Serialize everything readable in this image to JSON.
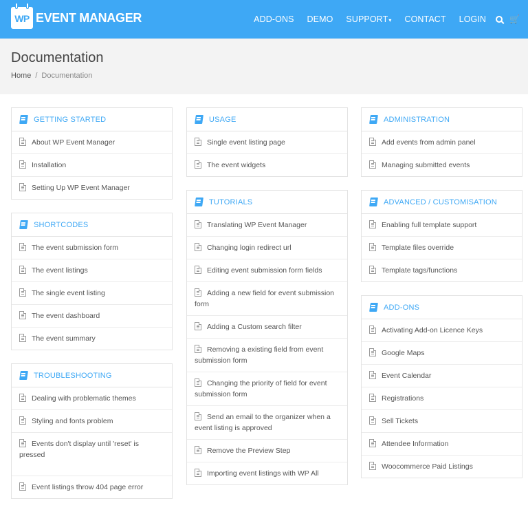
{
  "header": {
    "logo_badge": "WP",
    "logo_text": "EVENT MANAGER",
    "nav": [
      {
        "label": "ADD-ONS"
      },
      {
        "label": "DEMO"
      },
      {
        "label": "SUPPORT"
      },
      {
        "label": "CONTACT"
      },
      {
        "label": "LOGIN"
      }
    ],
    "support_caret": "▾",
    "cart_glyph": "🛒",
    "brand_color": "#3ea8f5"
  },
  "title_band": {
    "title": "Documentation",
    "breadcrumb_home": "Home",
    "breadcrumb_sep": "/",
    "breadcrumb_current": "Documentation"
  },
  "columns": {
    "col1": [
      {
        "title": "GETTING STARTED",
        "items": [
          "About WP Event Manager",
          "Installation",
          "Setting Up WP Event Manager"
        ]
      },
      {
        "title": "SHORTCODES",
        "items": [
          "The event submission form",
          "The event listings",
          "The single event listing",
          "The event dashboard",
          "The event summary"
        ]
      },
      {
        "title": "TROUBLESHOOTING",
        "items": [
          "Dealing with problematic themes",
          "Styling and fonts problem",
          "Events don't display until 'reset' is pressed",
          "Event listings throw 404 page error"
        ]
      }
    ],
    "col2": [
      {
        "title": "USAGE",
        "items": [
          "Single event listing page",
          "The event widgets"
        ]
      },
      {
        "title": "TUTORIALS",
        "items": [
          "Translating WP Event Manager",
          "Changing login redirect url",
          "Editing event submission form fields",
          "Adding a new field for event submission form",
          "Adding a Custom search filter",
          "Removing a existing field from event submission form",
          "Changing the priority of field for event submission form",
          "Send an email to the organizer when a event listing is approved",
          "Remove the Preview Step",
          "Importing event listings with WP All"
        ]
      }
    ],
    "col3": [
      {
        "title": "ADMINISTRATION",
        "items": [
          "Add events from admin panel",
          "Managing submitted events"
        ]
      },
      {
        "title": "ADVANCED / CUSTOMISATION",
        "items": [
          "Enabling full template support",
          "Template files override",
          "Template tags/functions"
        ]
      },
      {
        "title": "ADD-ONS",
        "items": [
          "Activating Add-on Licence Keys",
          "Google Maps",
          "Event Calendar",
          "Registrations",
          "Sell Tickets",
          "Attendee Information",
          "Woocommerce Paid Listings"
        ]
      }
    ]
  }
}
